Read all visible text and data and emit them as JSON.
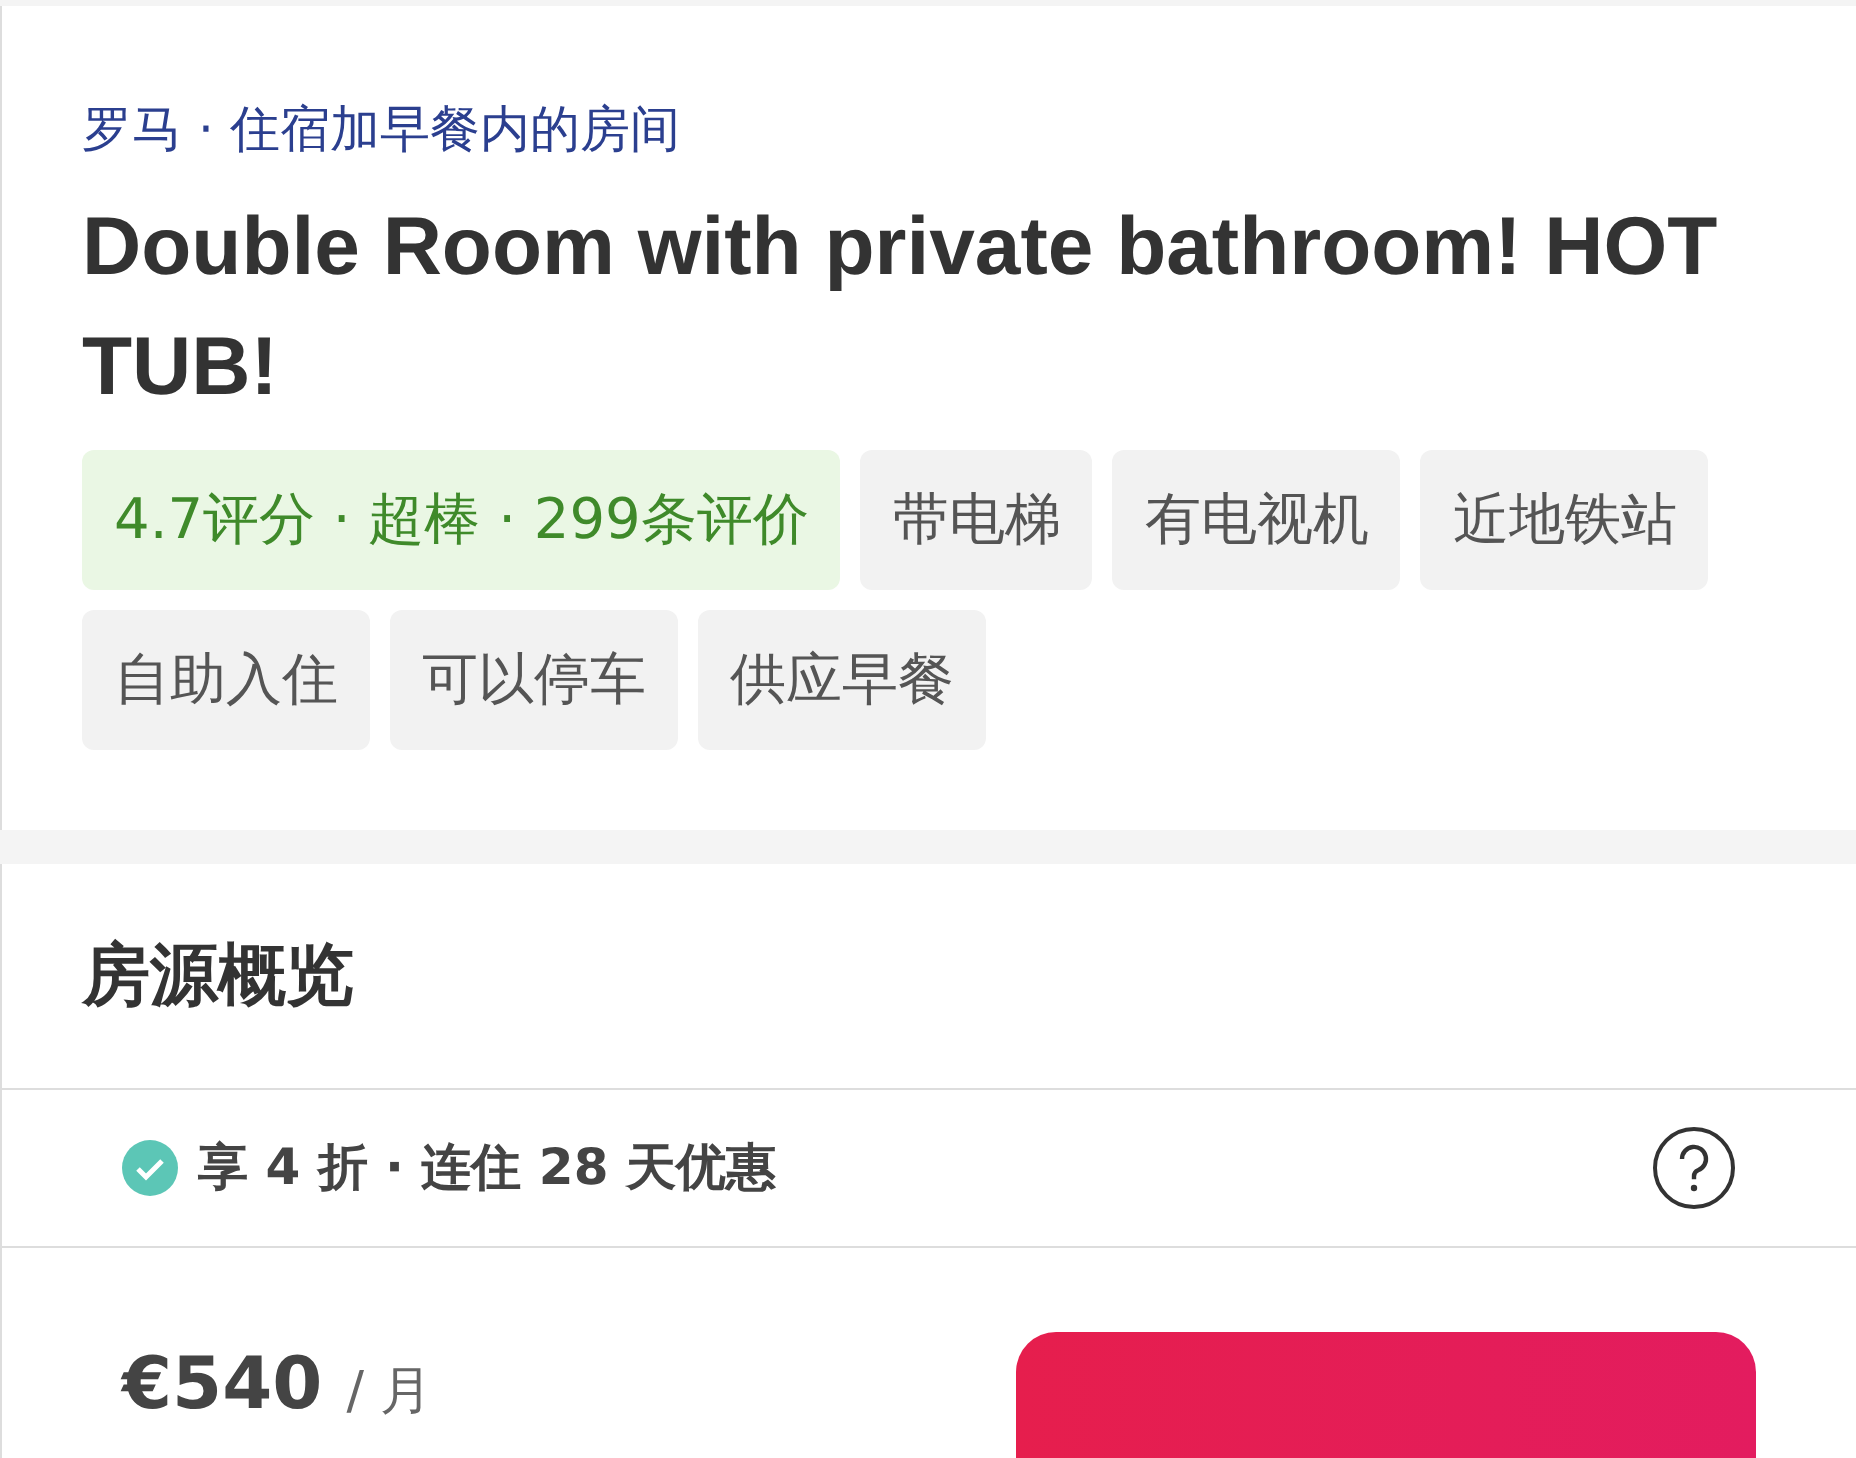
{
  "listing": {
    "breadcrumb": "罗马 · 住宿加早餐内的房间",
    "title": "Double Room with private bathroom! HOT TUB!",
    "tags": [
      {
        "kind": "rating",
        "label": "4.7评分 · 超棒 · 299条评价"
      },
      {
        "kind": "feature",
        "label": "带电梯"
      },
      {
        "kind": "feature",
        "label": "有电视机"
      },
      {
        "kind": "feature",
        "label": "近地铁站"
      },
      {
        "kind": "feature",
        "label": "自助入住"
      },
      {
        "kind": "feature",
        "label": "可以停车"
      },
      {
        "kind": "feature",
        "label": "供应早餐"
      }
    ]
  },
  "overview": {
    "heading": "房源概览",
    "discount": "享 **4 折** · 连住 28 天优惠",
    "price": "€540",
    "unit": "/ 月"
  }
}
